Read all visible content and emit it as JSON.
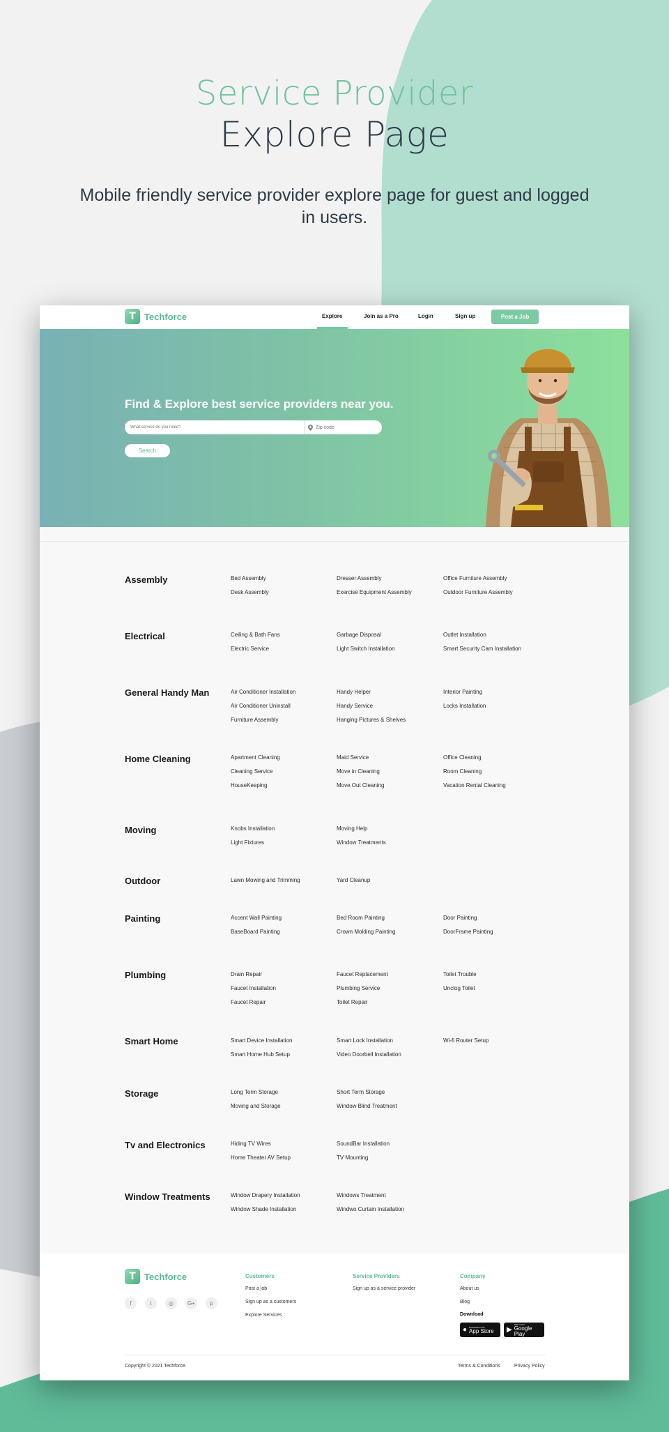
{
  "page": {
    "title_line1": "Service Provider",
    "title_line2": "Explore Page",
    "subtitle": "Mobile friendly service provider explore page for guest and logged in users."
  },
  "colors": {
    "accent": "#6cc39c",
    "dark_text": "#2e3a47",
    "mint_shape": "#b2ded0",
    "bottom_shape": "#60bb99",
    "grey_shape": "#c9ccd0"
  },
  "nav": {
    "brand": "Techforce",
    "logo_icon": "T",
    "links": [
      "Explore",
      "Join as a Pro",
      "Login",
      "Sign up"
    ],
    "active": "Explore",
    "cta": "Post a Job"
  },
  "banner": {
    "heading": "Find & Explore best service providers near you.",
    "search_placeholder": "What service do you need?",
    "zip_placeholder": "Zip code",
    "button": "Search"
  },
  "categories": [
    {
      "name": "Assembly",
      "services": [
        [
          "Bed Assembly",
          "Desk Assembly"
        ],
        [
          "Dresser Assembly",
          "Exercise Equipment Assembly"
        ],
        [
          "Office Furniture Assembly",
          "Outdoor Furniture Assembly"
        ]
      ]
    },
    {
      "name": "Electrical",
      "services": [
        [
          "Ceiling & Bath Fans",
          "Electric Service"
        ],
        [
          "Garbage Disposal",
          "Light Switch Installation"
        ],
        [
          "Outlet Installation",
          "Smart Security Cam Installation"
        ]
      ]
    },
    {
      "name": "General Handy Man",
      "services": [
        [
          "Air Conditioner Installation",
          "Air Conditioner Uninstall",
          "Furniture Assembly"
        ],
        [
          "Handy Helper",
          "Handy Service",
          "Hanging Pictures & Shelves"
        ],
        [
          "Interior Painting",
          "Locks Installation"
        ]
      ]
    },
    {
      "name": "Home Cleaning",
      "services": [
        [
          "Apartment Cleaning",
          "Cleaning Service",
          "HouseKeeping"
        ],
        [
          "Maid Service",
          "Move in Cleaning",
          "Move Out Cleaning"
        ],
        [
          "Office Cleaning",
          "Room Cleaning",
          "Vacation Rental Cleaning"
        ]
      ]
    },
    {
      "name": "Moving",
      "services": [
        [
          "Knobs Installation",
          "Light Fixtures"
        ],
        [
          "Moving Help",
          "Window Treatments"
        ]
      ]
    },
    {
      "name": "Outdoor",
      "services": [
        [
          "Lawn Mowing and Trimming"
        ],
        [
          "Yard Cleanup"
        ]
      ]
    },
    {
      "name": "Painting",
      "services": [
        [
          "Accent Wall Painting",
          "BaseBoard Painting"
        ],
        [
          "Bed Room Painting",
          "Crown Molding Painting"
        ],
        [
          "Door Painting",
          "DoorFrame Painting"
        ]
      ]
    },
    {
      "name": "Plumbing",
      "services": [
        [
          "Drain Repair",
          "Faucet Installation",
          "Faucet Repair"
        ],
        [
          "Faucet Replacement",
          "Plumbing Service",
          "Toilet Repair"
        ],
        [
          "Toilet Trouble",
          "Unclog Toilet"
        ]
      ]
    },
    {
      "name": "Smart Home",
      "services": [
        [
          "Smart Device Installation",
          "Smart Home Hub Setup"
        ],
        [
          "Smart Lock Installation",
          "Video Doorbell Installation"
        ],
        [
          "Wi-fi Router Setup"
        ]
      ]
    },
    {
      "name": "Storage",
      "services": [
        [
          "Long Term Storage",
          "Moving and Storage"
        ],
        [
          "Short Term Storage",
          "Window Blind Treatment"
        ]
      ]
    },
    {
      "name": "Tv and Electronics",
      "services": [
        [
          "Hiding TV Wires",
          "Home Theater AV Setup"
        ],
        [
          "SoundBar Installation",
          "TV Mounting"
        ]
      ]
    },
    {
      "name": "Window Treatments",
      "services": [
        [
          "Window Drapery Installation",
          "Window Shade Installation"
        ],
        [
          "Windows Treatment",
          "Windwo Curtain Installation"
        ]
      ]
    }
  ],
  "footer": {
    "brand": "Techforce",
    "social_icons": [
      "facebook-icon",
      "twitter-icon",
      "instagram-icon",
      "google-plus-icon",
      "pinterest-icon"
    ],
    "social_glyphs": [
      "f",
      "t",
      "◎",
      "G+",
      "p"
    ],
    "columns": [
      {
        "title": "Customers",
        "links": [
          "Post a job",
          "Sign up as a customers",
          "Explore Services"
        ]
      },
      {
        "title": "Service Providers",
        "links": [
          "Sign up as a service provider"
        ]
      },
      {
        "title": "Company",
        "links": [
          "About us",
          "Blog"
        ]
      }
    ],
    "download_label": "Download",
    "app_store": {
      "small": "Download on the",
      "big": "App Store"
    },
    "google_play": {
      "small": "GET IT ON",
      "big": "Google Play"
    },
    "copyright": "Copyright © 2021 Techforce.",
    "legal": [
      "Terms & Conditions",
      "Privacy Policy"
    ]
  }
}
